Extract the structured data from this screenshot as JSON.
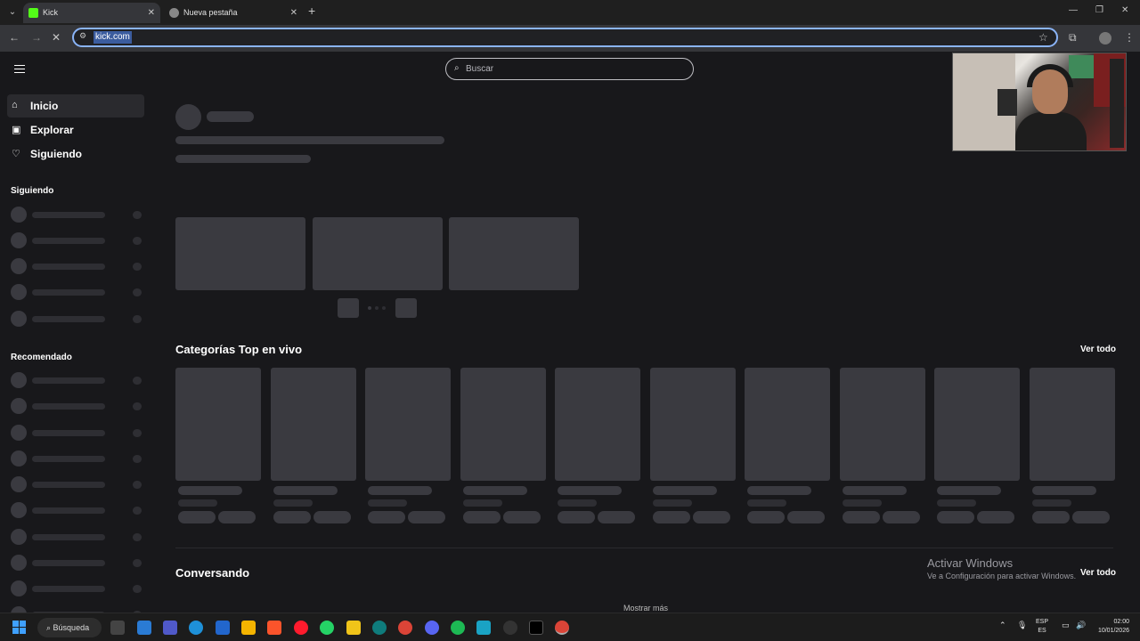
{
  "browser": {
    "tabs": [
      {
        "title": "Kick",
        "favicon_color": "#53fc18",
        "active": true
      },
      {
        "title": "Nueva pestaña",
        "active": false
      }
    ],
    "address": "kick.com"
  },
  "page": {
    "search_placeholder": "Buscar",
    "nav": [
      {
        "label": "Inicio",
        "icon": "home-icon",
        "active": true
      },
      {
        "label": "Explorar",
        "icon": "compass-icon",
        "active": false
      },
      {
        "label": "Siguiendo",
        "icon": "heart-icon",
        "active": false
      }
    ],
    "sidebar_sections": {
      "following": "Siguiendo",
      "recommended": "Recomendado"
    },
    "top_categories_title": "Categorías Top en vivo",
    "see_all": "Ver todo",
    "conversing_title": "Conversando",
    "show_more": "Mostrar más",
    "accent_color": "#53fc18"
  },
  "watermark": {
    "line1": "Activar Windows",
    "line2": "Ve a Configuración para activar Windows."
  },
  "taskbar": {
    "search_label": "Búsqueda",
    "lang_top": "ESP",
    "lang_bottom": "ES",
    "time": "02:00",
    "date": "10/01/2026"
  }
}
